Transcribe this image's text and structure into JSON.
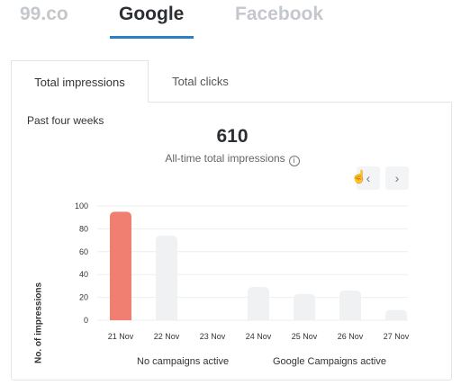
{
  "top_tabs": [
    {
      "label": "99.co",
      "active": false
    },
    {
      "label": "Google",
      "active": true
    },
    {
      "label": "Facebook",
      "active": false
    }
  ],
  "card_tabs": [
    {
      "label": "Total impressions",
      "active": true
    },
    {
      "label": "Total clicks",
      "active": false
    }
  ],
  "card": {
    "period": "Past four weeks",
    "total_value": "610",
    "total_label": "All-time total impressions",
    "info_icon": "info-icon",
    "nav_prev": "‹",
    "nav_next": "›"
  },
  "campaign_labels": {
    "none": "No campaigns active",
    "google": "Google Campaigns active"
  },
  "colors": {
    "highlight_bar": "#f07f72",
    "default_bar": "#f0f1f2",
    "accent_underline": "#2b7fc4"
  },
  "chart_data": {
    "type": "bar",
    "categories": [
      "21 Nov",
      "22 Nov",
      "23 Nov",
      "24 Nov",
      "25 Nov",
      "26 Nov",
      "27 Nov"
    ],
    "values": [
      95,
      74,
      0,
      29,
      23,
      26,
      9
    ],
    "highlighted_index": 0,
    "ylabel": "No. of impressions",
    "ylim": [
      0,
      100
    ],
    "yticks": [
      0,
      20,
      40,
      60,
      80,
      100
    ],
    "grid": true
  }
}
